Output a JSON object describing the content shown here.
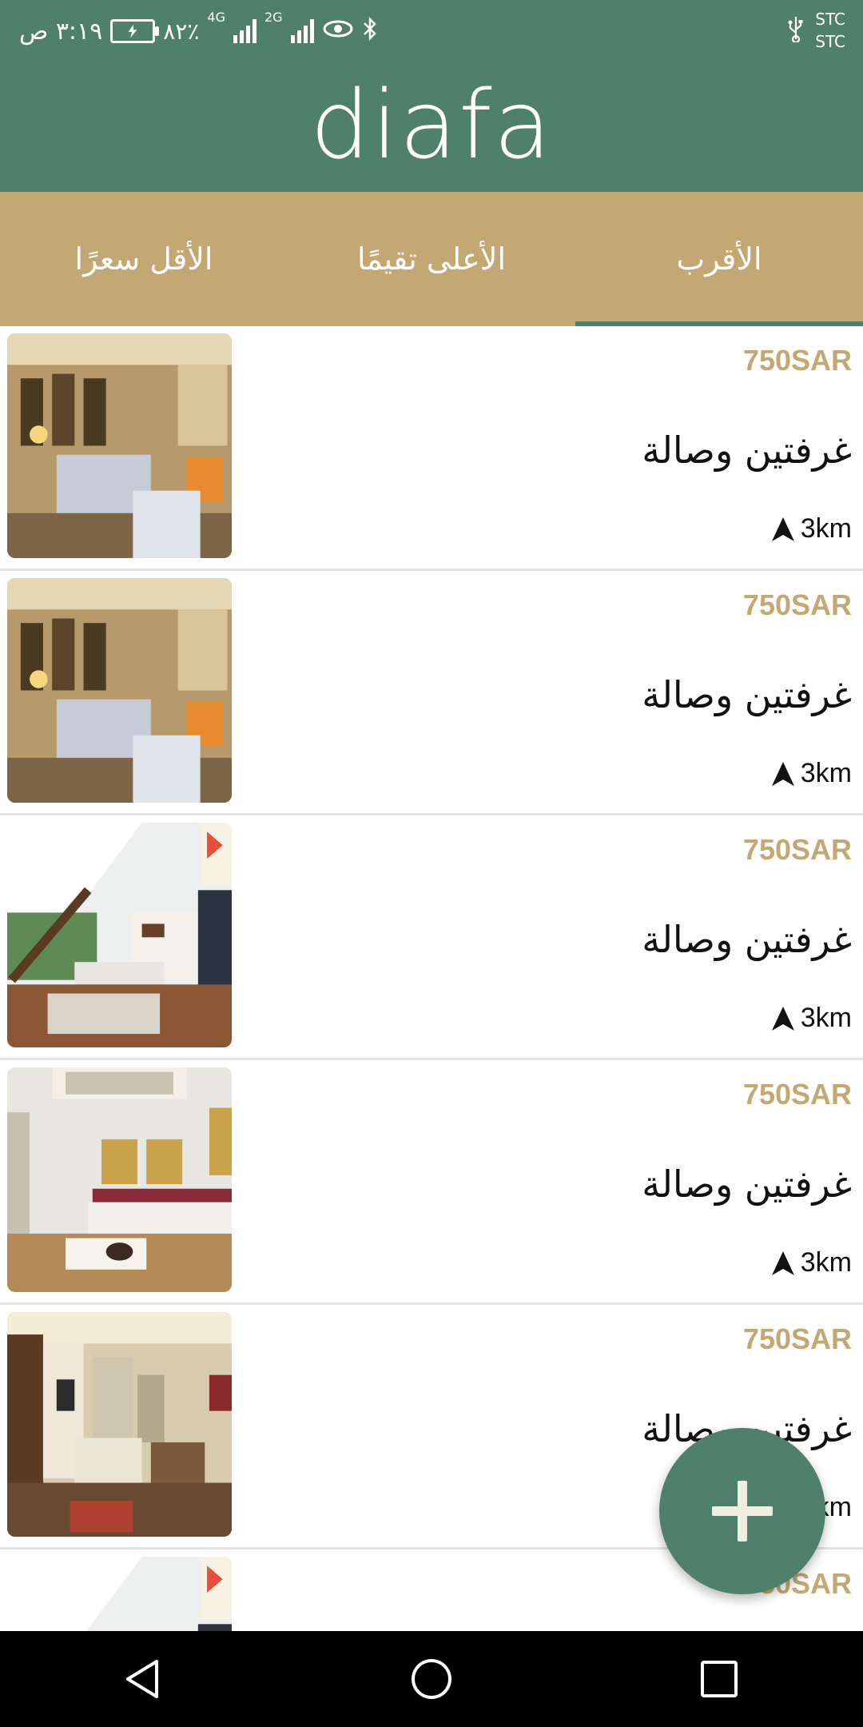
{
  "status_bar": {
    "time": "٣:١٩ ص",
    "battery": "٨٢٪",
    "network_1": "4G",
    "network_2": "2G",
    "carrier_1": "STC",
    "carrier_2": "STC",
    "icons": [
      "battery-charging-icon",
      "signal-icon",
      "eye-icon",
      "bluetooth-icon",
      "usb-icon"
    ]
  },
  "app_bar": {
    "logo": "diafa"
  },
  "tabs": [
    {
      "label": "الأقل سعرًا",
      "active": false
    },
    {
      "label": "الأعلى تقيمًا",
      "active": false
    },
    {
      "label": "الأقرب",
      "active": true
    }
  ],
  "listings": [
    {
      "price": "750SAR",
      "title": "غرفتين وصالة",
      "distance": "3km",
      "image": "living-room-photo"
    },
    {
      "price": "750SAR",
      "title": "غرفتين وصالة",
      "distance": "3km",
      "image": "living-room-photo"
    },
    {
      "price": "750SAR",
      "title": "غرفتين وصالة",
      "distance": "3km",
      "image": "living-room-photo"
    },
    {
      "price": "750SAR",
      "title": "غرفتين وصالة",
      "distance": "3km",
      "image": "living-room-photo"
    },
    {
      "price": "750SAR",
      "title": "غرفتين وصالة",
      "distance": "3km",
      "image": "living-room-photo"
    },
    {
      "price": "750SAR",
      "title": "",
      "distance": "",
      "image": "living-room-photo"
    }
  ],
  "fab": {
    "icon": "plus-icon"
  },
  "colors": {
    "primary": "#4f806c",
    "accent": "#c4a873",
    "divider": "#e4e4e4"
  }
}
